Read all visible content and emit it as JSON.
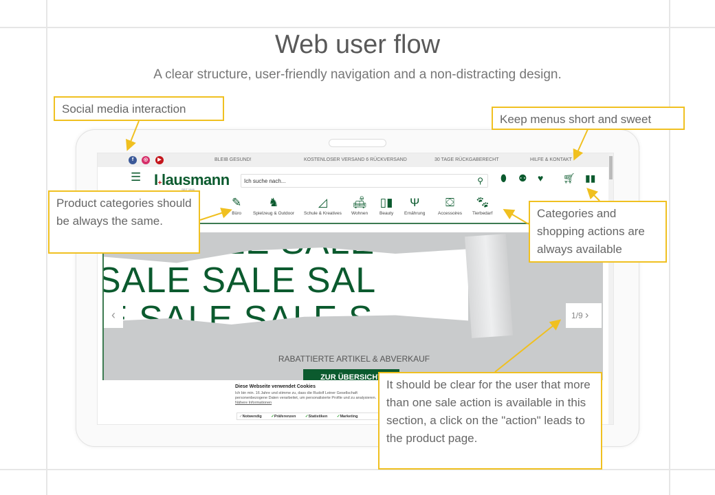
{
  "slide": {
    "title": "Web user flow",
    "subtitle": "A clear structure, user-friendly navigation and a non-distracting design."
  },
  "annotations": {
    "social": "Social media interaction",
    "menus": "Keep menus short and sweet",
    "categories": "Product categories should be always the same.",
    "shopping": "Categories and shopping actions are always available",
    "slider": "It should be clear for the user that more than one sale action is available in this section, a click on the \"action\" leads to the product page.",
    "accent": "#f0c020"
  },
  "site": {
    "brand_color": "#0b5a2e",
    "topbar": [
      "BLEIB GESUND!",
      "KOSTENLOSER VERSAND 6 RÜCKVERSAND",
      "30 TAGE RÜCKGABERECHT",
      "HILFE & KONTAKT"
    ],
    "social_icons": [
      "facebook-icon",
      "instagram-icon",
      "youtube-icon"
    ],
    "logo": "I+lausmann",
    "since": "SEIT 1946",
    "search_placeholder": "Ich suche nach...",
    "header_icons": [
      "location-icon",
      "user-icon",
      "heart-icon",
      "cart-icon",
      "catalog-icon"
    ],
    "categories": [
      {
        "label": "Büro",
        "icon": "pencil-cup-icon"
      },
      {
        "label": "Spielzeug & Outdoor",
        "icon": "rocking-horse-icon"
      },
      {
        "label": "Schule & Kreatives",
        "icon": "set-square-icon"
      },
      {
        "label": "Wohnen",
        "icon": "living-room-icon"
      },
      {
        "label": "Beauty",
        "icon": "cosmetics-icon"
      },
      {
        "label": "Ernährung",
        "icon": "glass-fork-icon"
      },
      {
        "label": "Accessoires",
        "icon": "bag-icon"
      },
      {
        "label": "Tierbedarf",
        "icon": "pets-icon"
      }
    ],
    "banner": {
      "sale": "SALE SALE SAL",
      "sale_top": "ALE SALE SALE",
      "sale_bottom": "LE SALE SALE S",
      "text": "RABATTIERTE ARTIKEL & ABVERKAUF",
      "button": "ZUR ÜBERSICHT",
      "pager": "1/9"
    },
    "cookie": {
      "title": "Diese Webseite verwendet Cookies",
      "body": "Ich bin min. 16 Jahre und stimme zu, dass die Rudolf Leiner Gesellschaft personenbezogene Daten verarbeitet, um personalisierte Profile und zu analysieren.",
      "link": "Nähere Informationen",
      "options": [
        "Notwendig",
        "Präferenzen",
        "Statistiken",
        "Marketing"
      ]
    }
  }
}
